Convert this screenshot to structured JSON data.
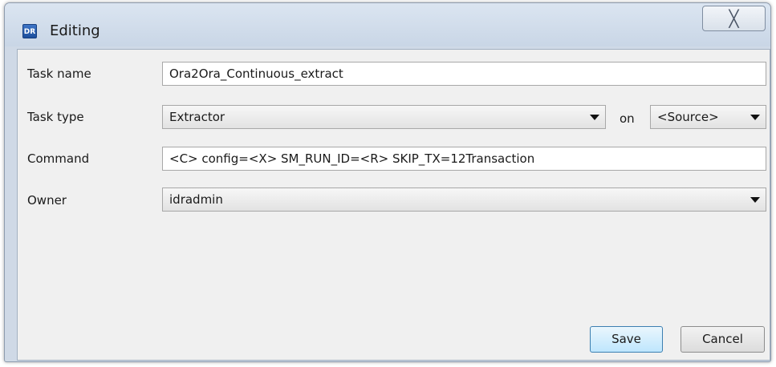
{
  "window": {
    "title": "Editing",
    "app_icon_text": "DR",
    "close_glyph": "╳"
  },
  "form": {
    "task_name": {
      "label": "Task name",
      "value": "Ora2Ora_Continuous_extract"
    },
    "task_type": {
      "label": "Task type",
      "value": "Extractor",
      "on_label": "on",
      "location_value": "<Source>"
    },
    "command": {
      "label": "Command",
      "value": "<C> config=<X> SM_RUN_ID=<R> SKIP_TX=12Transaction"
    },
    "owner": {
      "label": "Owner",
      "value": "idradmin"
    }
  },
  "buttons": {
    "save_label": "Save",
    "cancel_label": "Cancel"
  },
  "icons": {
    "app": "app-logo-icon",
    "close": "close-icon",
    "dropdown": "chevron-down-icon"
  }
}
